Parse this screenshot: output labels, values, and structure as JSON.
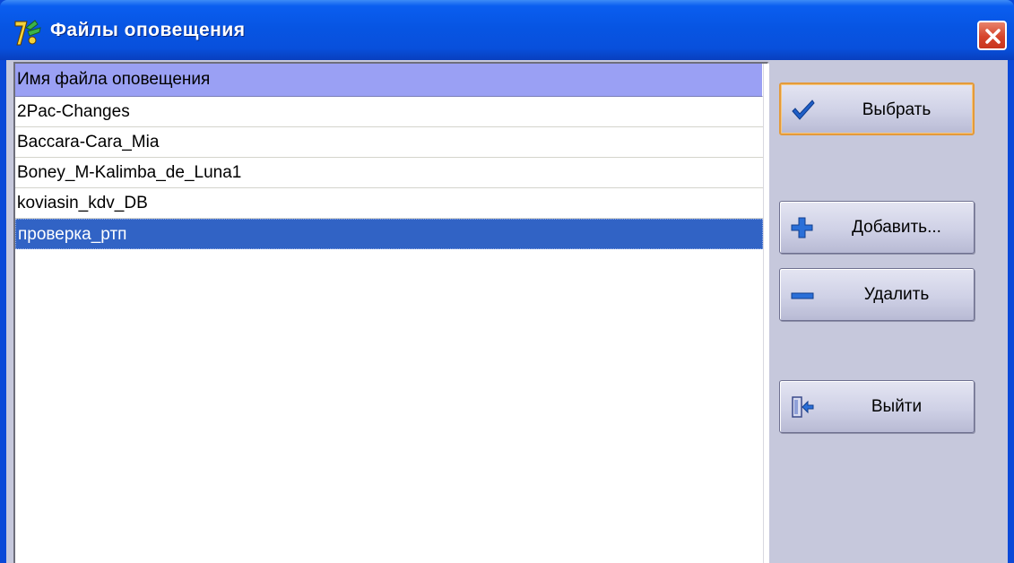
{
  "window": {
    "title": "Файлы оповещения",
    "title_color": "#0a5ef0",
    "close_color": "#d6452b"
  },
  "list": {
    "column_header": "Имя файла оповещения",
    "header_color": "#9aa0f4",
    "selection_color": "#3163c5",
    "items": [
      "2Pac-Changes",
      "Baccara-Cara_Mia",
      "Boney_M-Kalimba_de_Luna1",
      "koviasin_kdv_DB",
      "проверка_ртп"
    ],
    "selected_item": "проверка_ртп"
  },
  "buttons": {
    "select": {
      "label": "Выбрать",
      "icon": "checkmark-icon"
    },
    "add": {
      "label": "Добавить...",
      "icon": "plus-icon"
    },
    "delete": {
      "label": "Удалить",
      "icon": "minus-icon"
    },
    "exit": {
      "label": "Выйти",
      "icon": "exit-door-icon"
    }
  }
}
